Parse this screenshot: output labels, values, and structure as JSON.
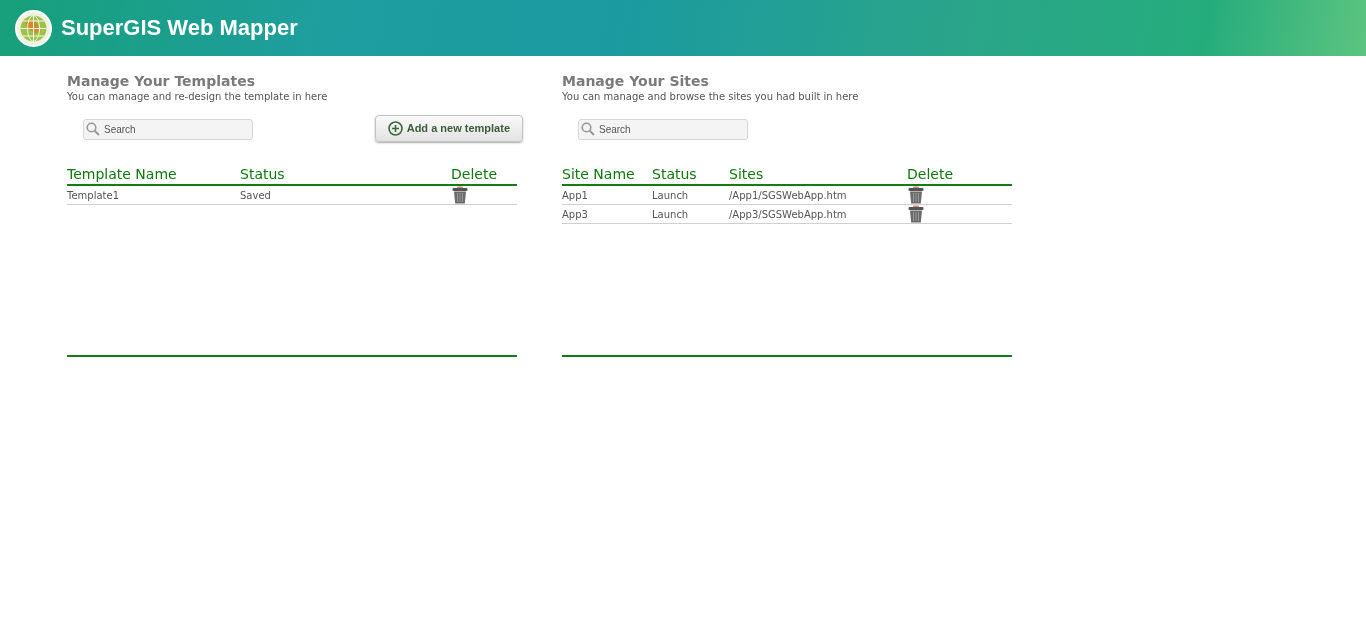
{
  "header": {
    "title": "SuperGIS Web Mapper"
  },
  "panels": [
    {
      "title": "Manage Your Templates",
      "subtitle": "You can manage and re-design the template in here",
      "search": {
        "placeholder": "Search"
      },
      "add_button": "Add a new template",
      "columns": [
        "Template Name",
        "Status",
        "Delete"
      ],
      "rows": [
        {
          "cells": [
            "Template1",
            "Saved"
          ]
        }
      ]
    },
    {
      "title": "Manage Your Sites",
      "subtitle": "You can manage and browse the sites you had built in here",
      "search": {
        "placeholder": "Search"
      },
      "columns": [
        "Site Name",
        "Status",
        "Sites",
        "Delete"
      ],
      "rows": [
        {
          "cells": [
            "App1",
            "Launch",
            "/App1/SGSWebApp.htm"
          ]
        },
        {
          "cells": [
            "App3",
            "Launch",
            "/App3/SGSWebApp.htm"
          ]
        }
      ]
    }
  ]
}
